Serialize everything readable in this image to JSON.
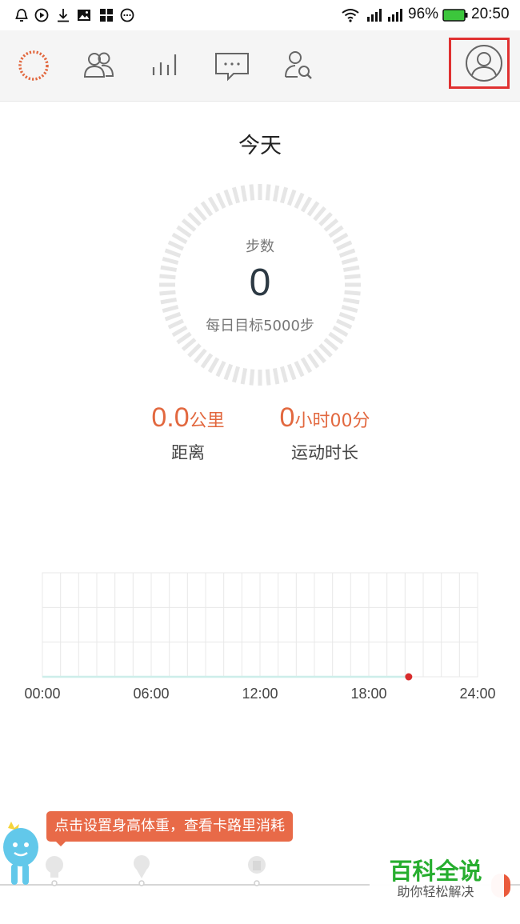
{
  "status_bar": {
    "battery": "96%",
    "time": "20:50",
    "icons": [
      "alarm-icon",
      "play-icon",
      "download-icon",
      "image-icon",
      "apps-icon",
      "chat-icon",
      "wifi-icon",
      "signal-icon",
      "signal-icon",
      "battery-icon"
    ]
  },
  "nav": {
    "tabs": [
      {
        "name": "today-tab",
        "icon": "dotted-ring-icon"
      },
      {
        "name": "friends-tab",
        "icon": "people-icon"
      },
      {
        "name": "stats-tab",
        "icon": "bar-chart-icon"
      },
      {
        "name": "messages-tab",
        "icon": "message-icon"
      },
      {
        "name": "find-friends-tab",
        "icon": "user-search-icon"
      },
      {
        "name": "profile-tab",
        "icon": "avatar-icon"
      }
    ]
  },
  "today": {
    "title": "今天",
    "steps_label": "步数",
    "steps_value": "0",
    "goal": "每日目标5000步",
    "steps_progress": 0
  },
  "metrics": {
    "distance": {
      "value": "0.0",
      "unit": "公里",
      "label": "距离"
    },
    "duration": {
      "hours": "0",
      "hours_unit": "小时",
      "minutes": "00",
      "minutes_unit": "分",
      "label": "运动时长"
    }
  },
  "chart_data": {
    "type": "line",
    "x_ticks": [
      "00:00",
      "06:00",
      "12:00",
      "18:00",
      "24:00"
    ],
    "xlim": [
      0,
      24
    ],
    "series": [
      {
        "values": [
          [
            0,
            0
          ],
          [
            20.2,
            0
          ]
        ]
      }
    ],
    "current_marker": {
      "x": 20.2,
      "y": 0
    },
    "grid": true,
    "colors": {
      "line": "#cdeeea",
      "marker": "#d82d2d",
      "grid": "#e8e8e8"
    }
  },
  "tip": {
    "text": "点击设置身高体重，查看卡路里消耗"
  },
  "watermark": {
    "title": "百科全说",
    "subtitle": "助你轻松解决"
  },
  "colors": {
    "accent": "#e2683f",
    "tip_bg": "#e86a48",
    "highlight": "#e03030",
    "ring": "#e6e6e6"
  }
}
